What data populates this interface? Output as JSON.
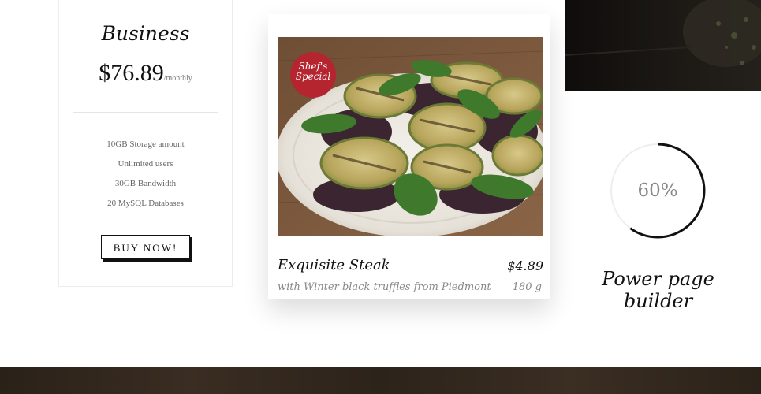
{
  "pricing": {
    "plan_name": "Business",
    "price": "$76.89",
    "period": "/monthly",
    "features": [
      "10GB Storage amount",
      "Unlimited users",
      "30GB Bandwidth",
      "20 MySQL Databases"
    ],
    "button_label": "BUY NOW!"
  },
  "menu_card": {
    "badge_line1": "Shef's",
    "badge_line2": "Special",
    "dish_name": "Exquisite Steak",
    "price": "$4.89",
    "description": "with Winter black truffles from Piedmont",
    "weight": "180 g",
    "badge_color": "#b52530"
  },
  "progress": {
    "value": 0.6,
    "label": "60%",
    "title": "Power page builder"
  },
  "colors": {
    "accent": "#111111",
    "muted_text": "#888888",
    "dark_wood": "#2c231b"
  }
}
